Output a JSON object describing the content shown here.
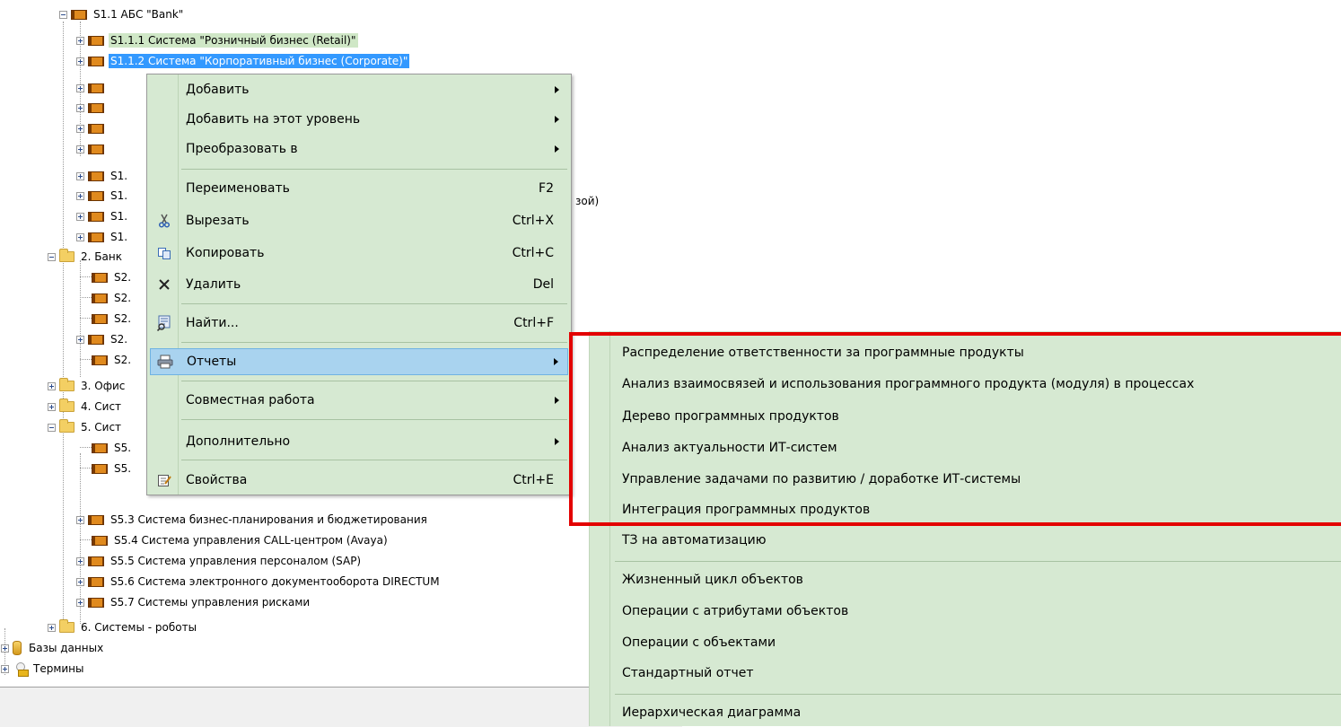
{
  "tree": {
    "nodes": [
      {
        "label": "S1.1 АБС \"Bank\""
      },
      {
        "label": "S1.1.1 Система \"Розничный бизнес (Retail)\""
      },
      {
        "label": "S1.1.2 Система \"Корпоративный бизнес (Corporate)\""
      },
      {
        "label": "S1."
      },
      {
        "label": "S1."
      },
      {
        "label": "S1."
      },
      {
        "label": "S1."
      },
      {
        "label": "2. Банк"
      },
      {
        "label": "S2."
      },
      {
        "label": "S2."
      },
      {
        "label": "S2."
      },
      {
        "label": "S2."
      },
      {
        "label": "S2."
      },
      {
        "label": "3. Офис"
      },
      {
        "label": "4. Сист"
      },
      {
        "label": "5. Сист"
      },
      {
        "label": "S5."
      },
      {
        "label": "S5."
      },
      {
        "label": "S5.3 Система бизнес-планирования и бюджетирования"
      },
      {
        "label": "S5.4 Система управления CALL-центром (Avaya)"
      },
      {
        "label": "S5.5 Система управления персоналом (SAP)"
      },
      {
        "label": "S5.6 Система электронного документооборота DIRECTUM"
      },
      {
        "label": "S5.7 Системы управления рисками"
      },
      {
        "label": "6. Системы - роботы"
      },
      {
        "label": "Базы данных"
      },
      {
        "label": "Термины"
      }
    ],
    "partial_overflow_text": "зой)"
  },
  "context_menu": {
    "items": [
      {
        "label": "Добавить",
        "shortcut": "",
        "submenu": true
      },
      {
        "label": "Добавить на этот уровень",
        "shortcut": "",
        "submenu": true
      },
      {
        "label": "Преобразовать в",
        "shortcut": "",
        "submenu": true
      },
      {
        "label": "Переименовать",
        "shortcut": "F2",
        "submenu": false
      },
      {
        "label": "Вырезать",
        "shortcut": "Ctrl+X",
        "submenu": false,
        "icon": "scissors-icon"
      },
      {
        "label": "Копировать",
        "shortcut": "Ctrl+C",
        "submenu": false,
        "icon": "copy-icon"
      },
      {
        "label": "Удалить",
        "shortcut": "Del",
        "submenu": false,
        "icon": "delete-icon"
      },
      {
        "label": "Найти...",
        "shortcut": "Ctrl+F",
        "submenu": false,
        "icon": "find-icon"
      },
      {
        "label": "Отчеты",
        "shortcut": "",
        "submenu": true,
        "icon": "printer-icon",
        "highlighted": true
      },
      {
        "label": "Совместная работа",
        "shortcut": "",
        "submenu": true
      },
      {
        "label": "Дополнительно",
        "shortcut": "",
        "submenu": true
      },
      {
        "label": "Свойства",
        "shortcut": "Ctrl+E",
        "submenu": false,
        "icon": "properties-icon"
      }
    ]
  },
  "reports_submenu": {
    "items": [
      {
        "label": "Распределение ответственности за программные продукты"
      },
      {
        "label": "Анализ взаимосвязей и использования программного продукта (модуля) в процессах"
      },
      {
        "label": "Дерево программных продуктов"
      },
      {
        "label": "Анализ актуальности ИТ-систем"
      },
      {
        "label": "Управление задачами по развитию / доработке ИТ-системы"
      },
      {
        "label": "Интеграция программных продуктов"
      },
      {
        "label": "ТЗ на автоматизацию"
      },
      {
        "label": "Жизненный цикл объектов"
      },
      {
        "label": "Операции с атрибутами объектов"
      },
      {
        "label": "Операции с объектами"
      },
      {
        "label": "Стандартный отчет"
      },
      {
        "label": "Иерархическая диаграмма"
      }
    ]
  },
  "colors": {
    "menu_bg": "#d6e9d2",
    "highlight_bg": "#a9d3ef",
    "selection_blue": "#3399ff",
    "selection_green": "#cfe7c6",
    "annotation_red": "#e30000"
  }
}
